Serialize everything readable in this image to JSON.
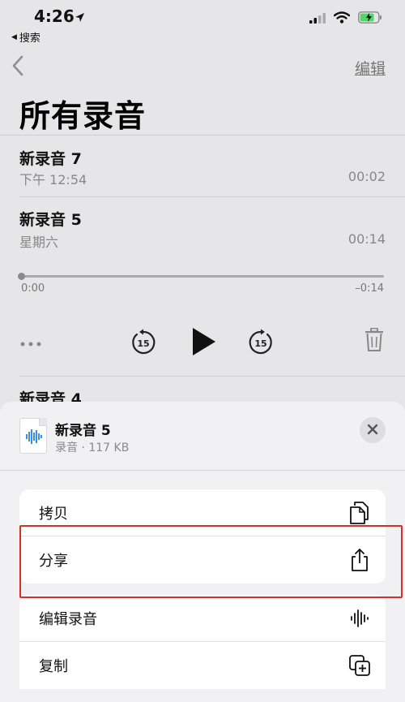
{
  "status_bar": {
    "time": "4:26",
    "back_app": "搜索"
  },
  "nav": {
    "edit_label": "编辑"
  },
  "page": {
    "title": "所有录音"
  },
  "recordings": [
    {
      "name": "新录音 7",
      "date": "下午 12:54",
      "duration": "00:02"
    },
    {
      "name": "新录音 5",
      "date": "星期六",
      "duration": "00:14"
    }
  ],
  "player": {
    "elapsed": "0:00",
    "remaining": "–0:14",
    "skip_back": "15",
    "skip_forward": "15"
  },
  "peek_recording": {
    "name": "新录音 4"
  },
  "share_sheet": {
    "file_name": "新录音 5",
    "file_meta": "录音 · 117 KB",
    "actions": [
      {
        "label": "拷贝",
        "icon": "copy-doc-icon"
      },
      {
        "label": "分享",
        "icon": "share-icon"
      },
      {
        "label": "编辑录音",
        "icon": "waveform-icon"
      },
      {
        "label": "复制",
        "icon": "duplicate-icon"
      }
    ]
  },
  "colors": {
    "highlight": "#d4312b",
    "battery": "#4cd964"
  }
}
